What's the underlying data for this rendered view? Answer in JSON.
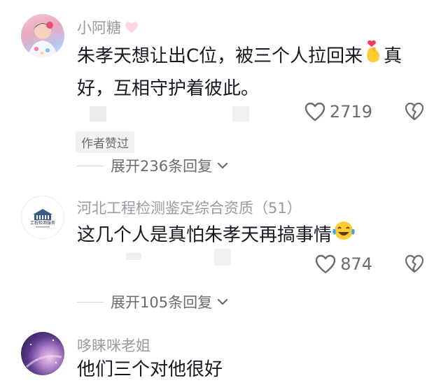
{
  "comments": [
    {
      "username": "小阿糖",
      "text_part1": "朱孝天想让出C位，被三个人拉回来",
      "text_part2": "真",
      "text_line2": "好，互相守护着彼此。",
      "likes": "2719",
      "badge": "作者赞过",
      "replies": "展开236条回复"
    },
    {
      "username": "河北工程检测鉴定综合资质（51）",
      "avatar_text": "工程检测服务",
      "text": "这几个人是真怕朱孝天再搞事情",
      "likes": "874",
      "replies": "展开105条回复"
    },
    {
      "username": "哆睐咪老姐",
      "text": "他们三个对他很好"
    }
  ],
  "colors": {
    "text_primary": "#161823",
    "text_secondary": "#9a9aa0",
    "icon": "#6b6b70"
  }
}
